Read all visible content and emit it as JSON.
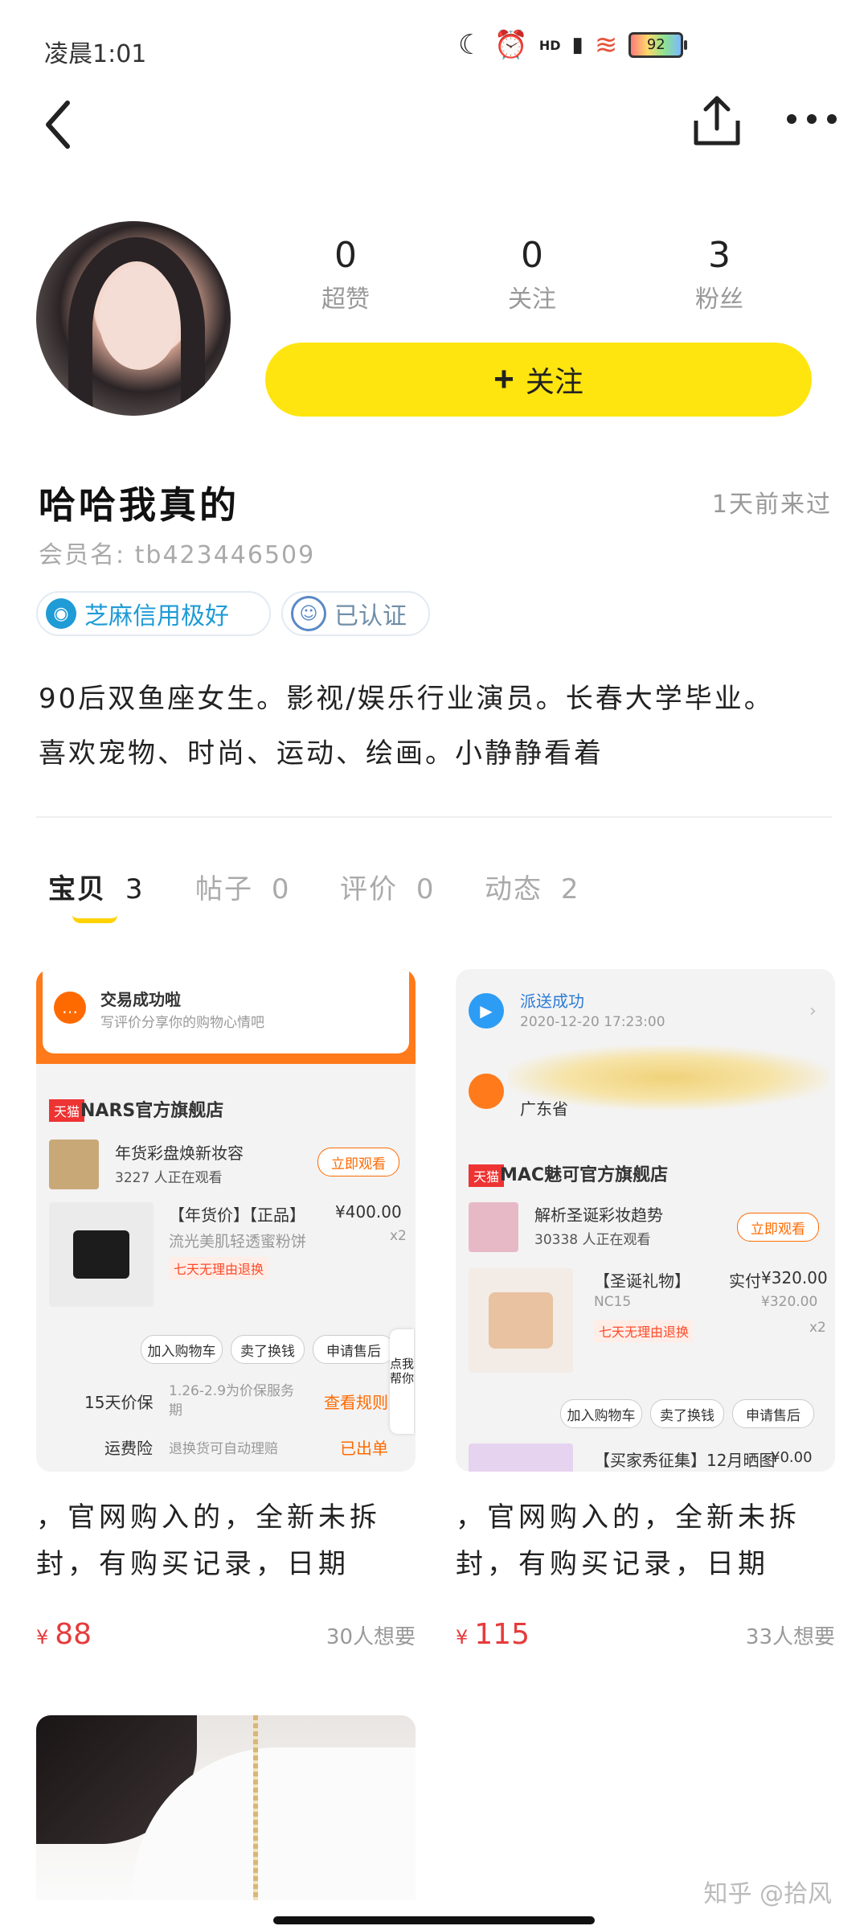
{
  "status_bar": {
    "time": "凌晨1:01",
    "battery": "92",
    "hd_label": "HD"
  },
  "profile": {
    "stats": [
      {
        "value": "0",
        "label": "超赞"
      },
      {
        "value": "0",
        "label": "关注"
      },
      {
        "value": "3",
        "label": "粉丝"
      }
    ],
    "follow_label": "关注",
    "name": "哈哈我真的",
    "visited": "1天前来过",
    "member": "会员名: tb423446509",
    "badges": [
      "芝麻信用极好",
      "已认证"
    ],
    "bio_lines": [
      "90后双鱼座女生。影视/娱乐行业演员。长春大学毕业。",
      "喜欢宠物、时尚、运动、绘画。小静静看着"
    ]
  },
  "tabs": [
    {
      "label": "宝贝",
      "count": "3"
    },
    {
      "label": "帖子",
      "count": "0"
    },
    {
      "label": "评价",
      "count": "0"
    },
    {
      "label": "动态",
      "count": "2"
    }
  ],
  "items": [
    {
      "title_line1": "，官网购入的，全新未拆",
      "title_line2": "封，有购买记录，日期",
      "currency": "¥",
      "price": "88",
      "want": "30人想要",
      "shot": {
        "banner_title": "交易成功啦",
        "banner_sub": "写评价分享你的购物心情吧",
        "store": "NARS官方旗舰店",
        "store_tag": "天猫",
        "live_title": "年货彩盘焕新妆容",
        "live_sub": "3227 人正在观看",
        "live_btn": "立即观看",
        "product_title": "【年货价】【正品】",
        "product_price": "¥400.00",
        "product_name": "流光美肌轻透蜜粉饼",
        "qty": "x2",
        "return_tag": "七天无理由退换",
        "buttons": [
          "加入购物车",
          "卖了换钱",
          "申请售后"
        ],
        "row1_label": "15天价保",
        "row1_desc": "1.26-2.9为价保服务期",
        "row1_link": "查看规则",
        "row2_label": "运费险",
        "row2_desc": "退换货可自动理赔",
        "row2_link": "已出单",
        "side_tab": "点我帮你"
      }
    },
    {
      "title_line1": "，官网购入的，全新未拆",
      "title_line2": "封，有购买记录，日期",
      "currency": "¥",
      "price": "115",
      "want": "33人想要",
      "shot": {
        "delivery_title": "派送成功",
        "delivery_time": "2020-12-20 17:23:00",
        "address": "广东省",
        "store": "MAC魅可官方旗舰店",
        "store_tag": "天猫",
        "live_title": "解析圣诞彩妆趋势",
        "live_sub": "30338 人正在观看",
        "live_btn": "立即观看",
        "product_title": "【圣诞礼物】",
        "paid_label": "实付",
        "paid_price": "¥320.00",
        "sub_price": "¥320.00",
        "product_name": "NC15",
        "qty": "x2",
        "return_tag": "七天无理由退换",
        "buttons": [
          "加入购物车",
          "卖了换钱",
          "申请售后"
        ],
        "bottom_title": "【买家秀征集】12月晒图",
        "bottom_price": "¥0.00"
      }
    }
  ],
  "watermark": "知乎 @拾风",
  "colors": {
    "accent": "#ffe50f",
    "price": "#e63b3b",
    "zhima": "#1f9bd6"
  }
}
